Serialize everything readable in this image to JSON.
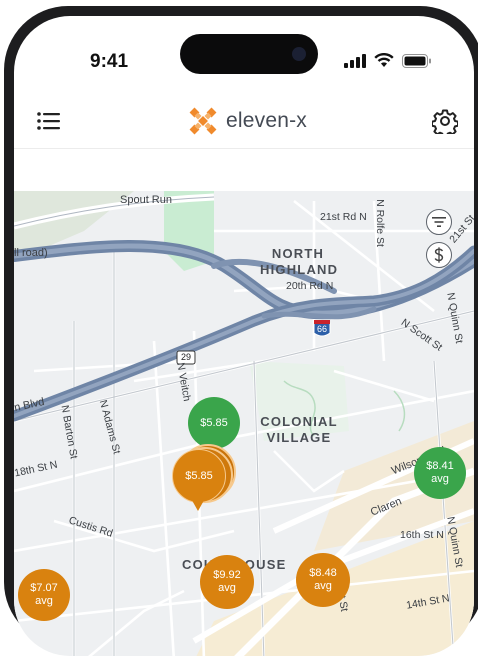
{
  "status_bar": {
    "time": "9:41"
  },
  "app": {
    "brand": "eleven-x",
    "brand_color": "#f08a2c"
  },
  "icons": {
    "menu": "hamburger-menu-icon",
    "settings": "gear-icon",
    "filter": "filter-icon",
    "price": "dollar-icon"
  },
  "map": {
    "roads": {
      "spout_run": "Spout Run",
      "toll_road": "ll road)",
      "blvd": "n Blvd",
      "n_21st": "21st Rd N",
      "n_20th": "20th Rd N",
      "n_rolfe": "N Rolfe St",
      "n_21st_st": "21st St",
      "n_quinn": "N Quinn St",
      "n_scott": "N Scott St",
      "n_veitch": "N Veitch",
      "n_barton": "N Barton St",
      "n_adams": "N Adams St",
      "n_18th": "18th St N",
      "custis": "Custis Rd",
      "wilson": "Wilson Blvd",
      "clarendon": "Claren",
      "n_16th": "16th St N",
      "quinn_lower": "N Quinn St",
      "n_14th": "14th St N",
      "ct_st": "ct St"
    },
    "shields": {
      "interstate": "66",
      "us_route": "29"
    },
    "neighborhoods": {
      "north_highland_1": "NORTH",
      "north_highland_2": "HIGHLAND",
      "colonial_1": "COLONIAL",
      "colonial_2": "VILLAGE",
      "courthouse": "COURTHOUSE"
    },
    "pins": [
      {
        "price": "$5.85",
        "sub": "",
        "color": "#3aa54b"
      },
      {
        "price": "$5.85",
        "sub": "",
        "color": "#d9820f"
      },
      {
        "price": "$8.41",
        "sub": "avg",
        "color": "#3aa54b"
      },
      {
        "price": "$7.07",
        "sub": "avg",
        "color": "#d9820f"
      },
      {
        "price": "$9.92",
        "sub": "avg",
        "color": "#d9820f"
      },
      {
        "price": "$8.48",
        "sub": "avg",
        "color": "#d9820f"
      }
    ]
  }
}
